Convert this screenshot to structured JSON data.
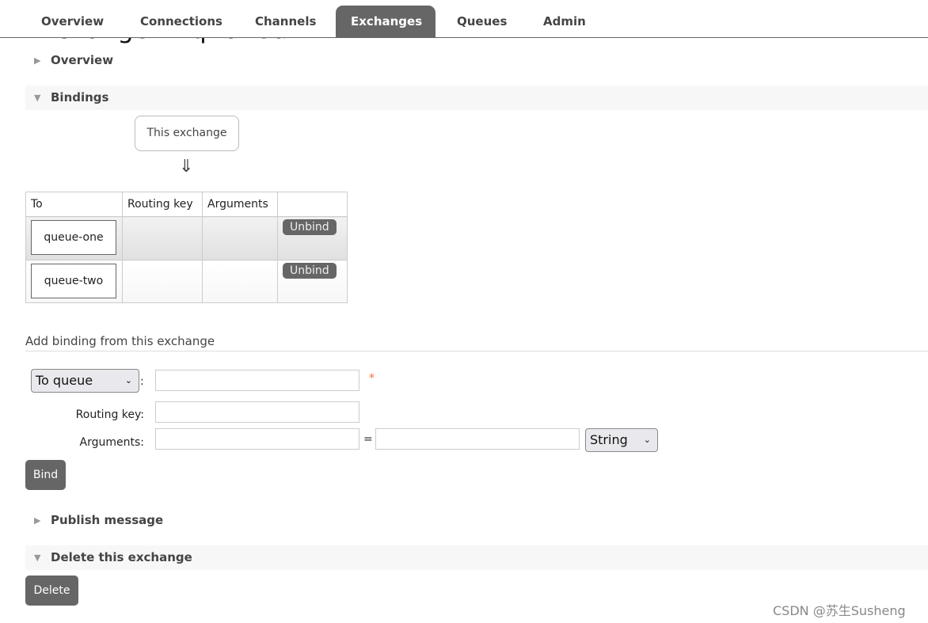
{
  "page": {
    "title": "Exchange: mq-fanout"
  },
  "nav": {
    "tabs": [
      {
        "label": "Overview"
      },
      {
        "label": "Connections"
      },
      {
        "label": "Channels"
      },
      {
        "label": "Exchanges",
        "active": true
      },
      {
        "label": "Queues"
      },
      {
        "label": "Admin"
      }
    ]
  },
  "sections": {
    "overview": "Overview",
    "bindings": "Bindings",
    "publish": "Publish message",
    "delete": "Delete this exchange"
  },
  "bindings": {
    "this_exchange": "This exchange",
    "arrow": "⇓",
    "columns": [
      "To",
      "Routing key",
      "Arguments",
      ""
    ],
    "rows": [
      {
        "to": "queue-one",
        "routing_key": "",
        "arguments": "",
        "action": "Unbind"
      },
      {
        "to": "queue-two",
        "routing_key": "",
        "arguments": "",
        "action": "Unbind"
      }
    ]
  },
  "add_binding": {
    "heading": "Add binding from this exchange",
    "destination_type": "To queue",
    "colon": ":",
    "required": "*",
    "routing_key_label": "Routing key:",
    "arguments_label": "Arguments:",
    "equals": "=",
    "arg_type": "String",
    "bind_label": "Bind"
  },
  "delete": {
    "button": "Delete"
  },
  "watermark": "CSDN @苏生Susheng",
  "colors": {
    "accent": "#666666",
    "section_bg": "#f7f7f7",
    "required": "#ff6633"
  }
}
